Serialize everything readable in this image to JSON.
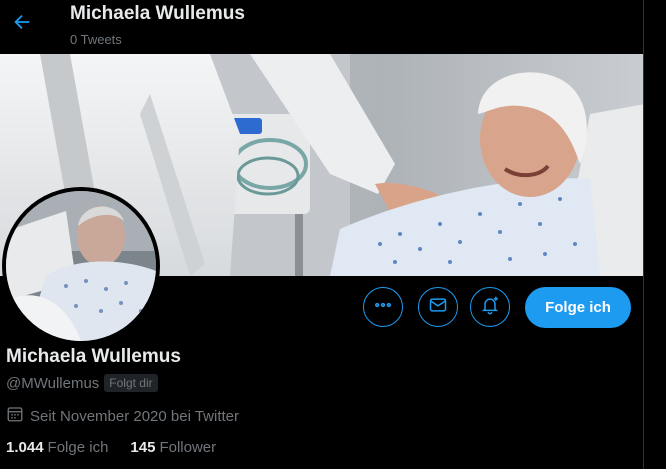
{
  "header": {
    "name": "Michaela Wullemus",
    "tweets_count": "0 Tweets"
  },
  "profile": {
    "name": "Michaela Wullemus",
    "handle": "@MWullemus",
    "follows_you_badge": "Folgt dir",
    "joined": "Seit November 2020 bei Twitter"
  },
  "stats": {
    "following_count": "1.044",
    "following_label": "Folge ich",
    "followers_count": "145",
    "followers_label": "Follower"
  },
  "actions": {
    "follow_label": "Folge ich"
  },
  "icons": {
    "back": "arrow-left-icon",
    "more": "more-icon",
    "message": "envelope-icon",
    "notify": "bell-plus-icon",
    "calendar": "calendar-icon"
  },
  "colors": {
    "accent": "#1d9bf0",
    "background": "#000000",
    "secondary_text": "#71767b",
    "primary_text": "#e7e9ea"
  }
}
